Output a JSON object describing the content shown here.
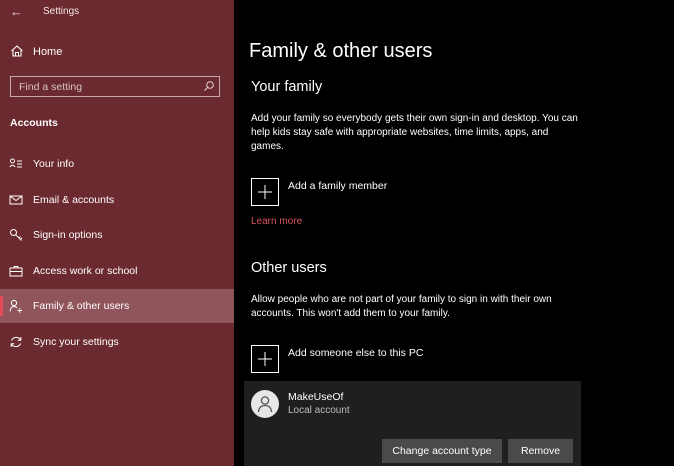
{
  "app": {
    "title": "Settings"
  },
  "sidebar": {
    "home_label": "Home",
    "search_placeholder": "Find a setting",
    "section": "Accounts",
    "items": [
      {
        "label": "Your info",
        "icon": "your-info-icon",
        "active": false
      },
      {
        "label": "Email & accounts",
        "icon": "mail-icon",
        "active": false
      },
      {
        "label": "Sign-in options",
        "icon": "key-icon",
        "active": false
      },
      {
        "label": "Access work or school",
        "icon": "briefcase-icon",
        "active": false
      },
      {
        "label": "Family & other users",
        "icon": "person-add-icon",
        "active": true
      },
      {
        "label": "Sync your settings",
        "icon": "sync-icon",
        "active": false
      }
    ]
  },
  "main": {
    "title": "Family & other users",
    "family": {
      "heading": "Your family",
      "description": "Add your family so everybody gets their own sign-in and desktop. You can help kids stay safe with appropriate websites, time limits, apps, and games.",
      "add_label": "Add a family member",
      "learn_more": "Learn more"
    },
    "other": {
      "heading": "Other users",
      "description": "Allow people who are not part of your family to sign in with their own accounts. This won't add them to your family.",
      "add_label": "Add someone else to this PC",
      "user": {
        "name": "MakeUseOf",
        "type": "Local account",
        "change_button": "Change account type",
        "remove_button": "Remove"
      }
    }
  },
  "colors": {
    "sidebar_bg": "#6b2a30",
    "active_bg": "#8f555a",
    "accent": "#e34b55",
    "link": "#d8565f"
  }
}
